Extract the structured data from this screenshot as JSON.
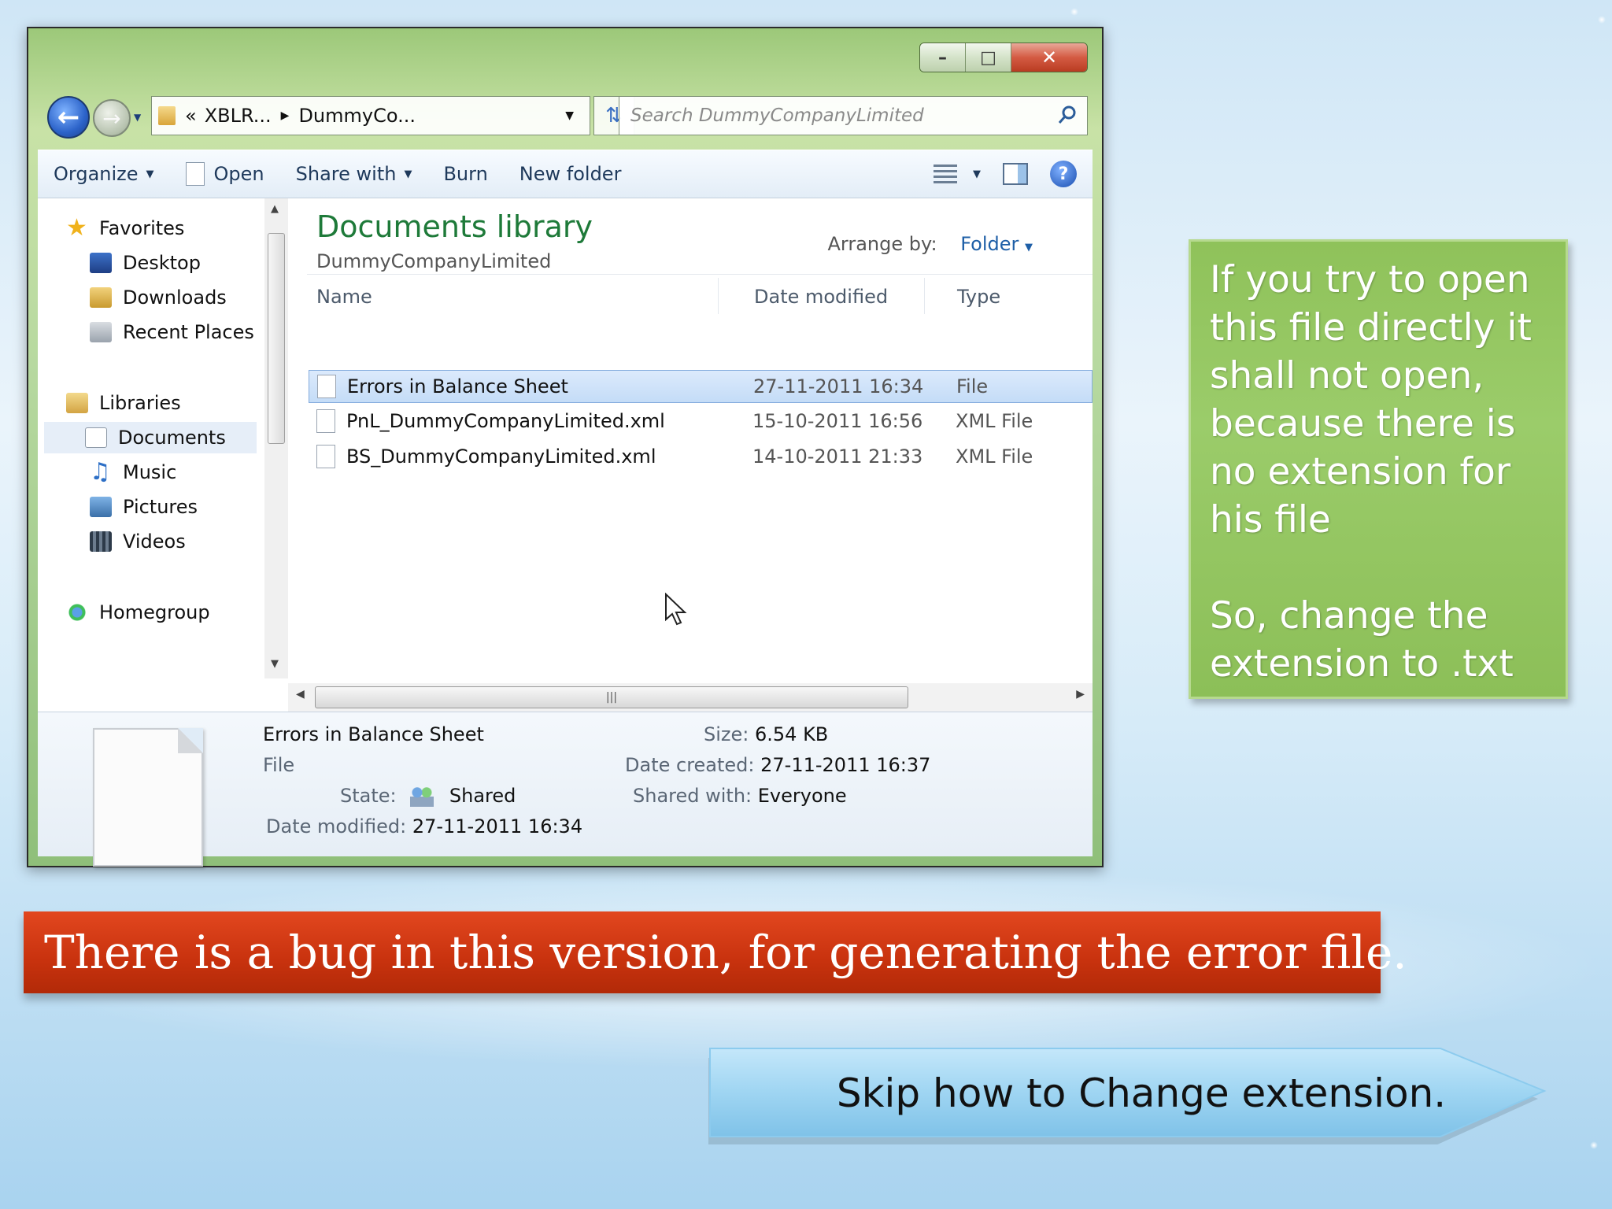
{
  "window": {
    "controls": {
      "minimize": "–",
      "maximize": "□",
      "close": "✕"
    },
    "breadcrumb": {
      "prefix": "«",
      "parent": "XBLR...",
      "current": "DummyCo..."
    },
    "search": {
      "placeholder": "Search DummyCompanyLimited"
    }
  },
  "toolbar": {
    "organize": "Organize",
    "open": "Open",
    "share_with": "Share with",
    "burn": "Burn",
    "new_folder": "New folder"
  },
  "nav_pane": {
    "favorites": "Favorites",
    "desktop": "Desktop",
    "downloads": "Downloads",
    "recent_places": "Recent Places",
    "libraries": "Libraries",
    "documents": "Documents",
    "music": "Music",
    "pictures": "Pictures",
    "videos": "Videos",
    "homegroup": "Homegroup"
  },
  "library": {
    "title": "Documents library",
    "subtitle": "DummyCompanyLimited",
    "arrange_label": "Arrange by:",
    "arrange_value": "Folder"
  },
  "columns": {
    "name": "Name",
    "date_modified": "Date modified",
    "type": "Type"
  },
  "files": [
    {
      "name": "Errors in Balance Sheet",
      "date": "27-11-2011 16:34",
      "type": "File"
    },
    {
      "name": "PnL_DummyCompanyLimited.xml",
      "date": "15-10-2011 16:56",
      "type": "XML File"
    },
    {
      "name": "BS_DummyCompanyLimited.xml",
      "date": "14-10-2011 21:33",
      "type": "XML File"
    }
  ],
  "details": {
    "name": "Errors in Balance Sheet",
    "kind": "File",
    "state_label": "State:",
    "state_value": "Shared",
    "date_modified_label": "Date modified:",
    "date_modified_value": "27-11-2011 16:34",
    "size_label": "Size:",
    "size_value": "6.54 KB",
    "date_created_label": "Date created:",
    "date_created_value": "27-11-2011 16:37",
    "shared_with_label": "Shared with:",
    "shared_with_value": "Everyone"
  },
  "callouts": {
    "note_line1": "If you try to open this file directly it shall not open, because there is no extension for his file",
    "note_line2": "So, change the extension to .txt",
    "banner": "There is a bug in this version, for generating the error file.",
    "skip_button": "Skip how to Change extension."
  },
  "colors": {
    "note_green": "#8fc25a",
    "banner_red": "#c8320e",
    "arrow_blue": "#9fd5f2",
    "library_title_green": "#1e7a39"
  }
}
